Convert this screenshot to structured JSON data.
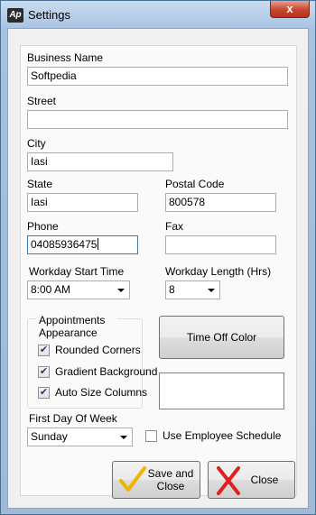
{
  "window": {
    "title": "Settings",
    "app_icon_text": "Ap",
    "close_glyph": "x"
  },
  "form": {
    "business_name": {
      "label": "Business Name",
      "value": "Softpedia"
    },
    "street": {
      "label": "Street",
      "value": ""
    },
    "city": {
      "label": "City",
      "value": "Iasi"
    },
    "state": {
      "label": "State",
      "value": "Iasi"
    },
    "postal_code": {
      "label": "Postal Code",
      "value": "800578"
    },
    "phone": {
      "label": "Phone",
      "value": "04085936475"
    },
    "fax": {
      "label": "Fax",
      "value": ""
    },
    "workday_start_time": {
      "label": "Workday Start Time",
      "selected": "8:00 AM"
    },
    "workday_length": {
      "label": "Workday Length (Hrs)",
      "selected": "8"
    },
    "first_day_of_week": {
      "label": "First Day Of Week",
      "selected": "Sunday"
    },
    "use_employee_schedule": {
      "label": "Use Employee Schedule",
      "checked": false
    }
  },
  "appointments": {
    "title": "Appointments Appearance",
    "options": [
      {
        "label": "Rounded Corners",
        "checked": true
      },
      {
        "label": "Gradient Background",
        "checked": true
      },
      {
        "label": "Auto Size Columns",
        "checked": true
      }
    ]
  },
  "time_off_color": {
    "button_label": "Time Off Color",
    "swatch_color": "#ffffff"
  },
  "buttons": {
    "save_close_line1": "Save and",
    "save_close_line2": "Close",
    "close_label": "Close"
  },
  "colors": {
    "frame": "#a6c2df",
    "close_button": "#c8452f",
    "check": "#f0b400",
    "x_mark": "#e0201c"
  }
}
